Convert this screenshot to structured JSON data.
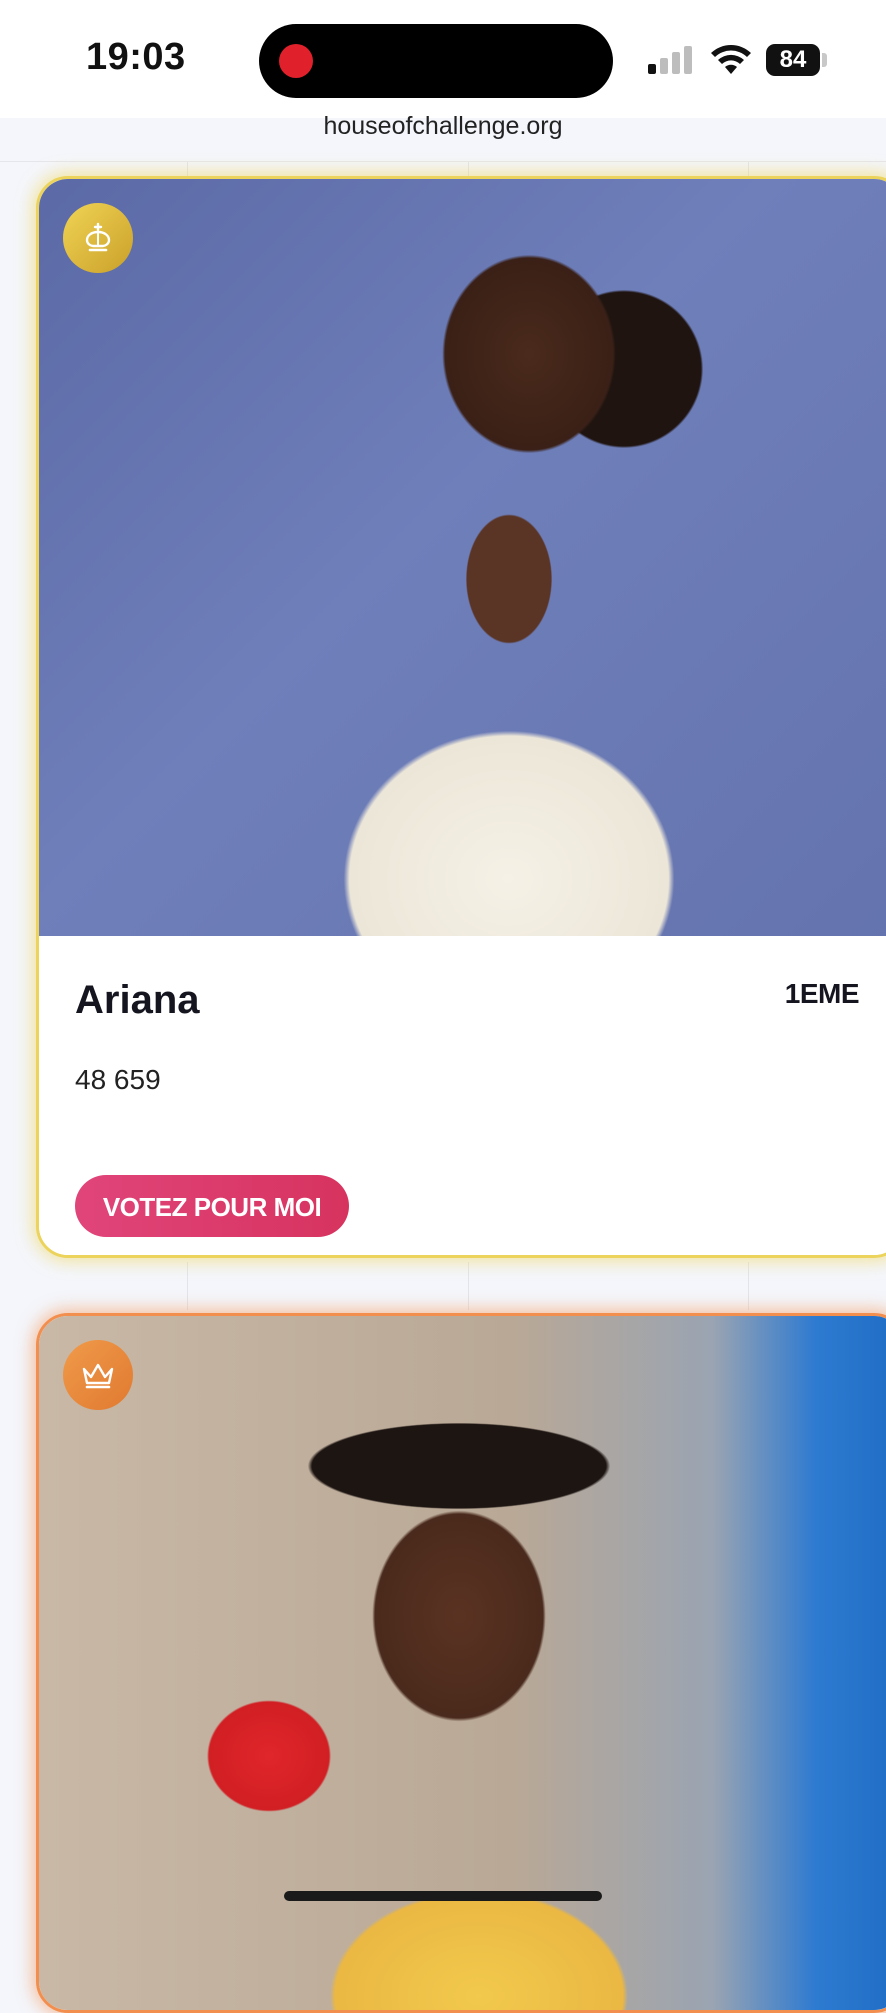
{
  "status_bar": {
    "time": "19:03",
    "battery": "84",
    "icons": [
      "signal-icon",
      "wifi-icon",
      "battery-icon",
      "screen-recording-icon"
    ]
  },
  "browser": {
    "url": "houseofchallenge.org"
  },
  "colors": {
    "gold_accent": "#ebd35c",
    "orange_accent": "#f28f4f",
    "button_pink": "#d7335f"
  },
  "candidates": [
    {
      "name": "Ariana",
      "rank": "1EME",
      "votes": "48 659",
      "button_label": "VOTEZ POUR MOI",
      "badge_icon": "king-crown-icon",
      "photo": "portrait-woman-white-blazer"
    },
    {
      "badge_icon": "crown-icon",
      "photo": "portrait-woman-yellow-dress-bantu-knots"
    }
  ]
}
